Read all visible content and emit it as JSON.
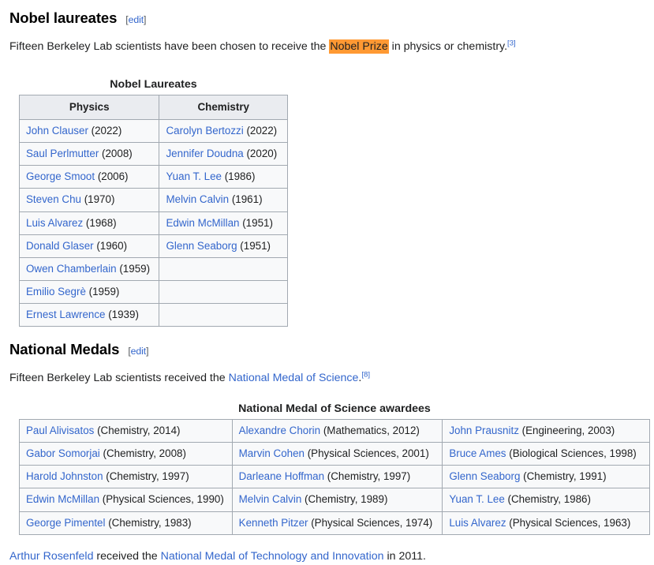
{
  "sections": {
    "nobel": {
      "heading": "Nobel laureates",
      "edit_open": "[",
      "edit_label": "edit",
      "edit_close": "]",
      "intro": {
        "before": "Fifteen Berkeley Lab scientists have been chosen to receive the ",
        "highlight": "Nobel Prize",
        "after": " in physics or chemistry.",
        "ref": "[3]"
      },
      "table": {
        "caption": "Nobel Laureates",
        "headers": [
          "Physics",
          "Chemistry"
        ],
        "rows": [
          [
            {
              "name": "John Clauser",
              "detail": " (2022)"
            },
            {
              "name": "Carolyn Bertozzi",
              "detail": " (2022)"
            }
          ],
          [
            {
              "name": "Saul Perlmutter",
              "detail": " (2008)"
            },
            {
              "name": "Jennifer Doudna",
              "detail": " (2020)"
            }
          ],
          [
            {
              "name": "George Smoot",
              "detail": " (2006)"
            },
            {
              "name": "Yuan T. Lee",
              "detail": " (1986)"
            }
          ],
          [
            {
              "name": "Steven Chu",
              "detail": " (1970)"
            },
            {
              "name": "Melvin Calvin",
              "detail": " (1961)"
            }
          ],
          [
            {
              "name": "Luis Alvarez",
              "detail": " (1968)"
            },
            {
              "name": "Edwin McMillan",
              "detail": " (1951)"
            }
          ],
          [
            {
              "name": "Donald Glaser",
              "detail": " (1960)"
            },
            {
              "name": "Glenn Seaborg",
              "detail": " (1951)"
            }
          ],
          [
            {
              "name": "Owen Chamberlain",
              "detail": " (1959)"
            },
            {
              "name": "",
              "detail": ""
            }
          ],
          [
            {
              "name": "Emilio Segrè",
              "detail": " (1959)"
            },
            {
              "name": "",
              "detail": ""
            }
          ],
          [
            {
              "name": "Ernest Lawrence",
              "detail": " (1939)"
            },
            {
              "name": "",
              "detail": ""
            }
          ]
        ]
      }
    },
    "medals": {
      "heading": "National Medals",
      "edit_open": "[",
      "edit_label": "edit",
      "edit_close": "]",
      "intro": {
        "before": "Fifteen Berkeley Lab scientists received the ",
        "link": "National Medal of Science",
        "after": ".",
        "ref": "[8]"
      },
      "table": {
        "caption": "National Medal of Science awardees",
        "rows": [
          [
            {
              "name": "Paul Alivisatos",
              "detail": " (Chemistry, 2014)"
            },
            {
              "name": "Alexandre Chorin",
              "detail": " (Mathematics, 2012)"
            },
            {
              "name": "John Prausnitz",
              "detail": " (Engineering, 2003)"
            }
          ],
          [
            {
              "name": "Gabor Somorjai",
              "detail": " (Chemistry, 2008)"
            },
            {
              "name": "Marvin Cohen",
              "detail": " (Physical Sciences, 2001)"
            },
            {
              "name": "Bruce Ames",
              "detail": " (Biological Sciences, 1998)"
            }
          ],
          [
            {
              "name": "Harold Johnston",
              "detail": " (Chemistry, 1997)"
            },
            {
              "name": "Darleane Hoffman",
              "detail": " (Chemistry, 1997)"
            },
            {
              "name": "Glenn Seaborg",
              "detail": " (Chemistry, 1991)"
            }
          ],
          [
            {
              "name": "Edwin McMillan",
              "detail": " (Physical Sciences, 1990)"
            },
            {
              "name": "Melvin Calvin",
              "detail": " (Chemistry, 1989)"
            },
            {
              "name": "Yuan T. Lee",
              "detail": " (Chemistry, 1986)"
            }
          ],
          [
            {
              "name": "George Pimentel",
              "detail": " (Chemistry, 1983)"
            },
            {
              "name": "Kenneth Pitzer",
              "detail": " (Physical Sciences, 1974)"
            },
            {
              "name": "Luis Alvarez",
              "detail": " (Physical Sciences, 1963)"
            }
          ]
        ]
      },
      "closing": {
        "link1": "Arthur Rosenfeld",
        "mid": " received the ",
        "link2": "National Medal of Technology and Innovation",
        "after": " in 2011."
      }
    }
  },
  "colors": {
    "link": "#3366cc",
    "highlight": "#ff9933",
    "text": "#202122",
    "table_border": "#a2a9b1",
    "table_header_bg": "#eaecf0",
    "table_bg": "#f8f9fa"
  }
}
